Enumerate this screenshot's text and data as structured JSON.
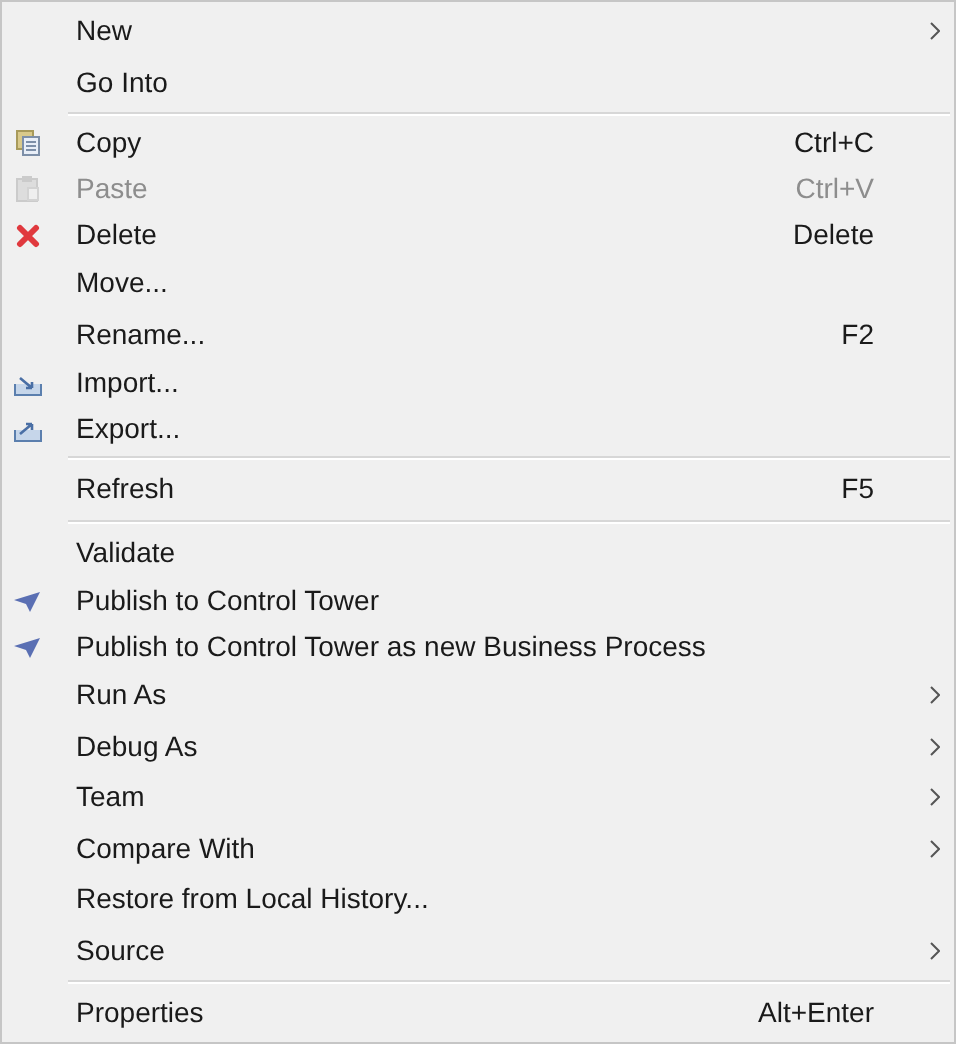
{
  "menu": {
    "groups": [
      {
        "items": [
          {
            "label": "New",
            "kind": "plain",
            "submenu": true,
            "disabled": false
          },
          {
            "label": "Go Into",
            "kind": "plain",
            "submenu": false,
            "disabled": false
          }
        ]
      },
      {
        "items": [
          {
            "label": "Copy",
            "kind": "copy",
            "shortcut": "Ctrl+C",
            "submenu": false,
            "disabled": false
          },
          {
            "label": "Paste",
            "kind": "paste",
            "shortcut": "Ctrl+V",
            "submenu": false,
            "disabled": true
          },
          {
            "label": "Delete",
            "kind": "delete",
            "shortcut": "Delete",
            "submenu": false,
            "disabled": false
          },
          {
            "label": "Move...",
            "kind": "plain",
            "submenu": false,
            "disabled": false
          },
          {
            "label": "Rename...",
            "kind": "plain",
            "shortcut": "F2",
            "submenu": false,
            "disabled": false
          },
          {
            "label": "Import...",
            "kind": "import",
            "submenu": false,
            "disabled": false
          },
          {
            "label": "Export...",
            "kind": "export",
            "submenu": false,
            "disabled": false
          }
        ]
      },
      {
        "items": [
          {
            "label": "Refresh",
            "kind": "plain",
            "shortcut": "F5",
            "submenu": false,
            "disabled": false
          }
        ]
      },
      {
        "items": [
          {
            "label": "Validate",
            "kind": "plain",
            "submenu": false,
            "disabled": false
          },
          {
            "label": "Publish to Control Tower",
            "kind": "publish",
            "submenu": false,
            "disabled": false
          },
          {
            "label": "Publish to Control Tower as new Business Process",
            "kind": "publish",
            "submenu": false,
            "disabled": false
          },
          {
            "label": "Run As",
            "kind": "plain",
            "submenu": true,
            "disabled": false
          },
          {
            "label": "Debug As",
            "kind": "plain",
            "submenu": true,
            "disabled": false
          },
          {
            "label": "Team",
            "kind": "plain",
            "submenu": true,
            "disabled": false
          },
          {
            "label": "Compare With",
            "kind": "plain",
            "submenu": true,
            "disabled": false
          },
          {
            "label": "Restore from Local History...",
            "kind": "plain",
            "submenu": false,
            "disabled": false
          },
          {
            "label": "Source",
            "kind": "plain",
            "submenu": true,
            "disabled": false
          }
        ]
      },
      {
        "items": [
          {
            "label": "Properties",
            "kind": "plain",
            "shortcut": "Alt+Enter",
            "submenu": false,
            "disabled": false
          }
        ]
      }
    ]
  }
}
